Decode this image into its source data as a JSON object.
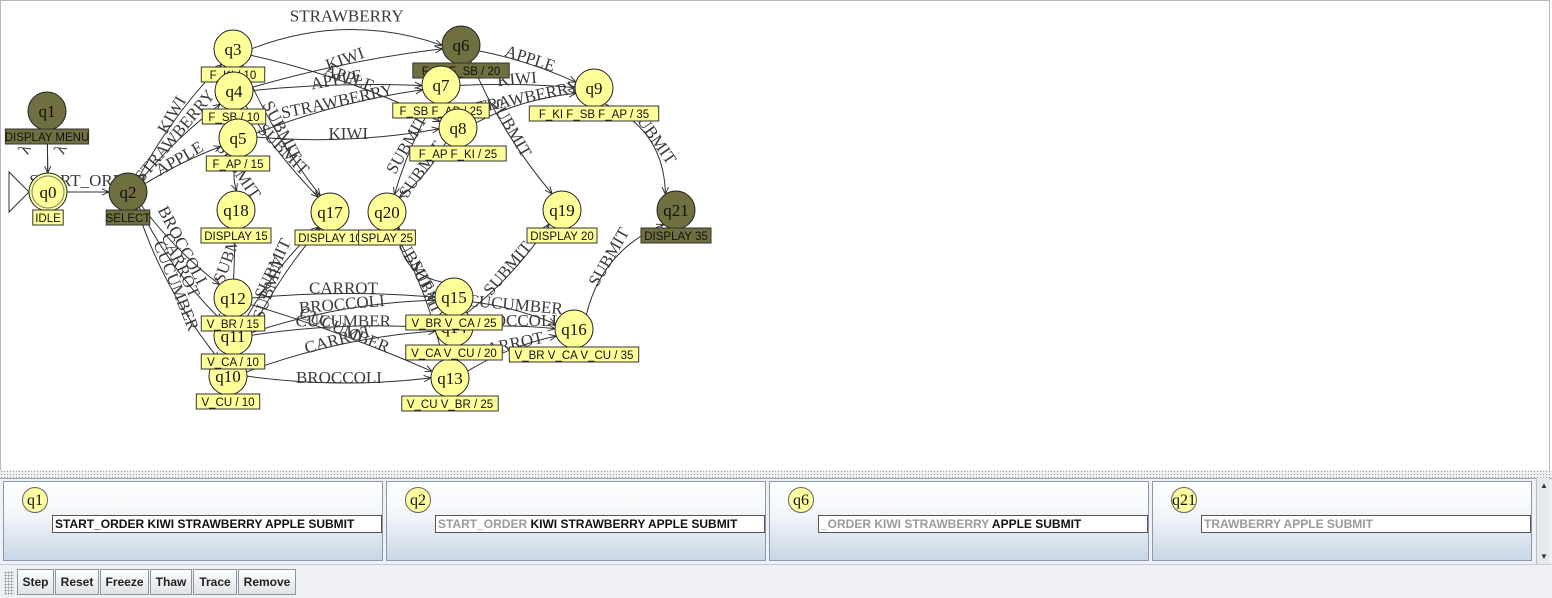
{
  "graph": {
    "colors": {
      "state": "#ffff99",
      "final_state": "#6f6f40",
      "label_box": "#ffff99",
      "label_box_final": "#6f6f40"
    },
    "nodes": [
      {
        "id": "q0",
        "label": "q0",
        "output": "IDLE",
        "final": false,
        "initial": true
      },
      {
        "id": "q1",
        "label": "q1",
        "output": "DISPLAY MENU",
        "final": true
      },
      {
        "id": "q2",
        "label": "q2",
        "output": "SELECT",
        "final": true
      },
      {
        "id": "q3",
        "label": "q3",
        "output": "F_KI / 10",
        "final": false
      },
      {
        "id": "q4",
        "label": "q4",
        "output": "F_SB / 10",
        "final": false
      },
      {
        "id": "q5",
        "label": "q5",
        "output": "F_AP / 15",
        "final": false
      },
      {
        "id": "q6",
        "label": "q6",
        "output": "F_KI F_SB / 20",
        "final": true
      },
      {
        "id": "q7",
        "label": "q7",
        "output": "F_SB F_AP / 25",
        "final": false
      },
      {
        "id": "q8",
        "label": "q8",
        "output": "F_AP F_KI / 25",
        "final": false
      },
      {
        "id": "q9",
        "label": "q9",
        "output": "F_KI F_SB F_AP / 35",
        "final": false
      },
      {
        "id": "q10",
        "label": "q10",
        "output": "V_CU / 10",
        "final": false
      },
      {
        "id": "q11",
        "label": "q11",
        "output": "V_CA / 10",
        "final": false
      },
      {
        "id": "q12",
        "label": "q12",
        "output": "V_BR / 15",
        "final": false
      },
      {
        "id": "q13",
        "label": "q13",
        "output": "V_CU V_BR / 25",
        "final": false
      },
      {
        "id": "q14",
        "label": "q14",
        "output": "V_CA V_CU / 20",
        "final": false
      },
      {
        "id": "q15",
        "label": "q15",
        "output": "V_BR V_CA / 25",
        "final": false
      },
      {
        "id": "q16",
        "label": "q16",
        "output": "V_BR V_CA V_CU / 35",
        "final": false
      },
      {
        "id": "q17",
        "label": "q17",
        "output": "DISPLAY 10",
        "final": false
      },
      {
        "id": "q18",
        "label": "q18",
        "output": "DISPLAY 15",
        "final": false
      },
      {
        "id": "q19",
        "label": "q19",
        "output": "DISPLAY 20",
        "final": false
      },
      {
        "id": "q20",
        "label": "q20",
        "output": "SPLAY 25",
        "final": false
      },
      {
        "id": "q21",
        "label": "q21",
        "output": "DISPLAY 35",
        "final": true
      }
    ],
    "edges": [
      {
        "from": "q0",
        "to": "q2",
        "label": "START_ORDER"
      },
      {
        "from": "q1",
        "to": "q0",
        "label": "λ"
      },
      {
        "from": "q0",
        "to": "q1",
        "label": "λ"
      },
      {
        "from": "q2",
        "to": "q3",
        "label": "KIWI"
      },
      {
        "from": "q2",
        "to": "q4",
        "label": "STRAWBERRY"
      },
      {
        "from": "q2",
        "to": "q5",
        "label": "APPLE"
      },
      {
        "from": "q2",
        "to": "q12",
        "label": "BROCCOLI"
      },
      {
        "from": "q2",
        "to": "q11",
        "label": "CARROT"
      },
      {
        "from": "q2",
        "to": "q10",
        "label": "CUCUMBER"
      },
      {
        "from": "q3",
        "to": "q6",
        "label": "STRAWBERRY"
      },
      {
        "from": "q3",
        "to": "q8",
        "label": "APPLE"
      },
      {
        "from": "q3",
        "to": "q17",
        "label": "SUBMIT"
      },
      {
        "from": "q4",
        "to": "q6",
        "label": "KIWI"
      },
      {
        "from": "q4",
        "to": "q7",
        "label": "APPLE"
      },
      {
        "from": "q4",
        "to": "q17",
        "label": "SUBMIT"
      },
      {
        "from": "q5",
        "to": "q7",
        "label": "STRAWBERRY"
      },
      {
        "from": "q5",
        "to": "q8",
        "label": "KIWI"
      },
      {
        "from": "q5",
        "to": "q18",
        "label": "SUBMIT"
      },
      {
        "from": "q6",
        "to": "q9",
        "label": "APPLE"
      },
      {
        "from": "q6",
        "to": "q19",
        "label": "SUBMIT"
      },
      {
        "from": "q7",
        "to": "q9",
        "label": "KIWI"
      },
      {
        "from": "q7",
        "to": "q20",
        "label": "SUBMIT"
      },
      {
        "from": "q8",
        "to": "q9",
        "label": "STRAWBERRY"
      },
      {
        "from": "q8",
        "to": "q20",
        "label": "SUBMIT"
      },
      {
        "from": "q9",
        "to": "q21",
        "label": "SUBMIT"
      },
      {
        "from": "q12",
        "to": "q15",
        "label": "CARROT"
      },
      {
        "from": "q12",
        "to": "q13",
        "label": "CUCUMBER"
      },
      {
        "from": "q12",
        "to": "q18",
        "label": "SUBMIT"
      },
      {
        "from": "q11",
        "to": "q15",
        "label": "BROCCOLI"
      },
      {
        "from": "q11",
        "to": "q14",
        "label": "CUCUMBER"
      },
      {
        "from": "q11",
        "to": "q17",
        "label": "SUBMIT"
      },
      {
        "from": "q10",
        "to": "q14",
        "label": "CARROT"
      },
      {
        "from": "q10",
        "to": "q13",
        "label": "BROCCOLI"
      },
      {
        "from": "q10",
        "to": "q17",
        "label": "SUBMIT"
      },
      {
        "from": "q15",
        "to": "q16",
        "label": "CUCUMBER"
      },
      {
        "from": "q15",
        "to": "q20",
        "label": "SUBMIT"
      },
      {
        "from": "q14",
        "to": "q16",
        "label": "BROCCOLI"
      },
      {
        "from": "q14",
        "to": "q19",
        "label": "SUBMIT"
      },
      {
        "from": "q13",
        "to": "q16",
        "label": "CARROT"
      },
      {
        "from": "q13",
        "to": "q20",
        "label": "SUBMIT"
      },
      {
        "from": "q16",
        "to": "q21",
        "label": "SUBMIT"
      }
    ]
  },
  "configurations": [
    {
      "state": "q1",
      "read": "",
      "rest": "START_ORDER KIWI STRAWBERRY APPLE SUBMIT"
    },
    {
      "state": "q2",
      "read": "START_ORDER ",
      "rest": "KIWI STRAWBERRY APPLE SUBMIT"
    },
    {
      "state": "q6",
      "read": "_ORDER KIWI STRAWBERRY ",
      "rest": "APPLE SUBMIT"
    },
    {
      "state": "q21",
      "read": "TRAWBERRY APPLE SUBMIT",
      "rest": ""
    }
  ],
  "toolbar": {
    "step": "Step",
    "reset": "Reset",
    "freeze": "Freeze",
    "thaw": "Thaw",
    "trace": "Trace",
    "remove": "Remove"
  }
}
